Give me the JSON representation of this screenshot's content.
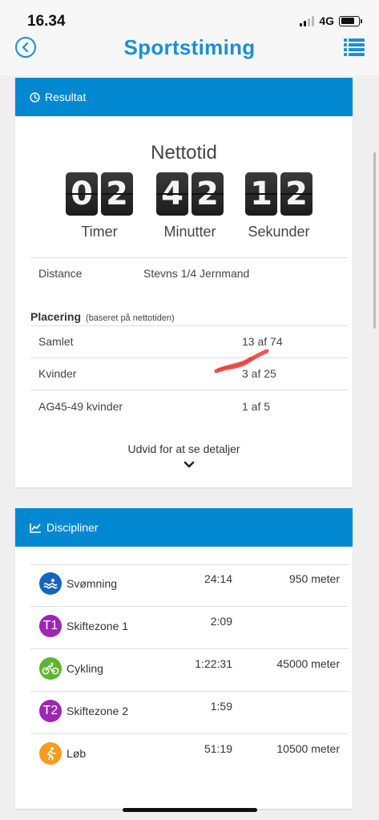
{
  "status_bar": {
    "time": "16.34",
    "network": "4G"
  },
  "header": {
    "title": "Sportstiming"
  },
  "result": {
    "header": "Resultat",
    "netto_title": "Nettotid",
    "hours": [
      "0",
      "2"
    ],
    "minutes": [
      "4",
      "2"
    ],
    "seconds": [
      "1",
      "2"
    ],
    "hours_label": "Timer",
    "minutes_label": "Minutter",
    "seconds_label": "Sekunder",
    "distance_label": "Distance",
    "distance_value": "Stevns 1/4 Jernmand",
    "placering_label": "Placering",
    "placering_note": "(baseret på nettotiden)",
    "rows": [
      {
        "label": "Samlet",
        "value": "13 af 74"
      },
      {
        "label": "Kvinder",
        "value": "3 af 25"
      },
      {
        "label": "AG45-49 kvinder",
        "value": "1 af 5"
      }
    ],
    "expand_label": "Udvid for at se detaljer"
  },
  "disciplines": {
    "header": "Discipliner",
    "items": [
      {
        "name": "Svømning",
        "time": "24:14",
        "distance": "950 meter",
        "icon": "swim-icon",
        "color": "#1565c0"
      },
      {
        "name": "Skiftezone 1",
        "time": "2:09",
        "distance": "",
        "icon": "T1",
        "color": "#9c27b0"
      },
      {
        "name": "Cykling",
        "time": "1:22:31",
        "distance": "45000 meter",
        "icon": "bike-icon",
        "color": "#5cb531"
      },
      {
        "name": "Skiftezone 2",
        "time": "1:59",
        "distance": "",
        "icon": "T2",
        "color": "#9c27b0"
      },
      {
        "name": "Løb",
        "time": "51:19",
        "distance": "10500 meter",
        "icon": "run-icon",
        "color": "#f39c1f"
      }
    ]
  },
  "colors": {
    "brand": "#1b8fd6",
    "card_header": "#0288d1",
    "annotation": "#e53935"
  }
}
